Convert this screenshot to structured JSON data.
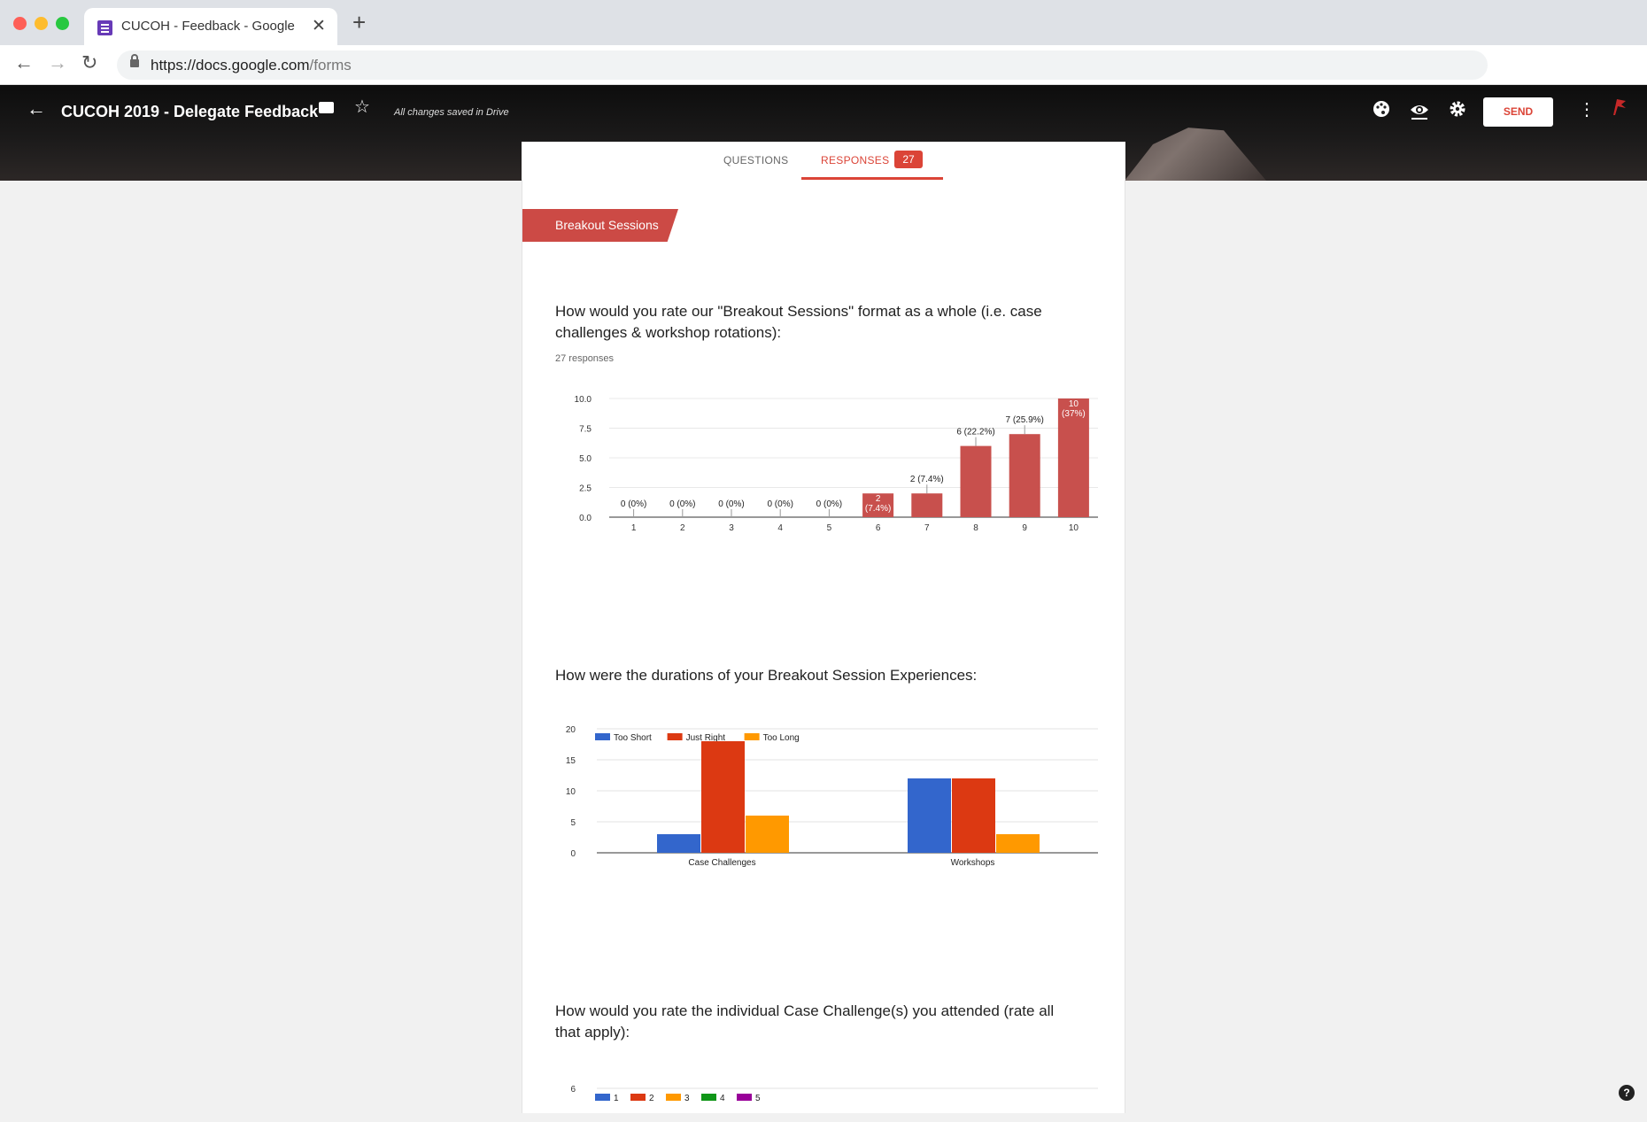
{
  "browser": {
    "tab_title": "CUCOH - Feedback - Google Forms",
    "url_host": "https://docs.google.com",
    "url_path": "/forms"
  },
  "header": {
    "form_title": "CUCOH 2019 - Delegate Feedback",
    "saved_status": "All changes saved in Drive",
    "send_label": "SEND"
  },
  "tabs": {
    "questions_label": "QUESTIONS",
    "responses_label": "RESPONSES",
    "responses_count": "27"
  },
  "section": {
    "title": "Breakout Sessions"
  },
  "q1": {
    "text": "How would you rate our \"Breakout Sessions\" format as a whole (i.e. case challenges & workshop rotations):",
    "responses": "27 responses"
  },
  "q2": {
    "text": "How were the durations of your Breakout Session Experiences:"
  },
  "q3": {
    "text": "How would you rate the individual Case Challenge(s) you attended (rate all that apply):"
  },
  "chart_data": [
    {
      "type": "bar",
      "categories": [
        "1",
        "2",
        "3",
        "4",
        "5",
        "6",
        "7",
        "8",
        "9",
        "10"
      ],
      "values": [
        0,
        0,
        0,
        0,
        0,
        2,
        2,
        6,
        7,
        10
      ],
      "data_labels": [
        "0 (0%)",
        "0 (0%)",
        "0 (0%)",
        "0 (0%)",
        "0 (0%)",
        "2 (7.4%)",
        "2 (7.4%)",
        "6 (22.2%)",
        "7 (25.9%)",
        "10 (37%)"
      ],
      "yticks": [
        "0.0",
        "2.5",
        "5.0",
        "7.5",
        "10.0"
      ],
      "ylim": [
        0,
        10
      ],
      "color": "#c8504d"
    },
    {
      "type": "bar",
      "categories": [
        "Case Challenges",
        "Workshops"
      ],
      "series": [
        {
          "name": "Too Short",
          "values": [
            3,
            12
          ],
          "color": "#3366cc"
        },
        {
          "name": "Just Right",
          "values": [
            18,
            12
          ],
          "color": "#dc3912"
        },
        {
          "name": "Too Long",
          "values": [
            6,
            3
          ],
          "color": "#ff9900"
        }
      ],
      "yticks": [
        "0",
        "5",
        "10",
        "15",
        "20"
      ],
      "ylim": [
        0,
        20
      ],
      "legend": "top"
    },
    {
      "type": "bar",
      "legend_entries": [
        {
          "name": "1",
          "color": "#3366cc"
        },
        {
          "name": "2",
          "color": "#dc3912"
        },
        {
          "name": "3",
          "color": "#ff9900"
        },
        {
          "name": "4",
          "color": "#109618"
        },
        {
          "name": "5",
          "color": "#990099"
        }
      ],
      "yticks": [
        "6"
      ],
      "legend": "top"
    }
  ]
}
